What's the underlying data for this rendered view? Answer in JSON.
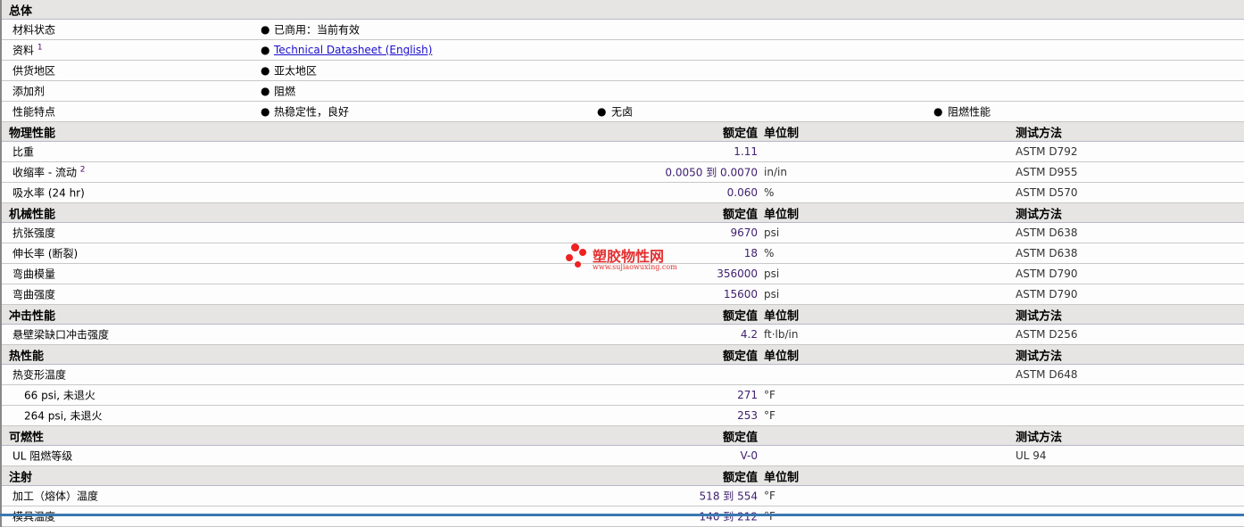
{
  "general": {
    "title": "总体",
    "rows": [
      {
        "label": "材料状态",
        "items": [
          "已商用：当前有效"
        ]
      },
      {
        "label": "资料",
        "sup": "1",
        "items": [
          "Technical Datasheet (English)"
        ],
        "link": true
      },
      {
        "label": "供货地区",
        "items": [
          "亚太地区"
        ]
      },
      {
        "label": "添加剂",
        "items": [
          "阻燃"
        ]
      },
      {
        "label": "性能特点",
        "items": [
          "热稳定性，良好",
          "无卤",
          "阻燃性能"
        ]
      }
    ]
  },
  "sections": [
    {
      "title": "物理性能",
      "col_value": "额定值",
      "col_unit": "单位制",
      "col_test": "测试方法",
      "rows": [
        {
          "label": "比重",
          "value": "1.11",
          "unit": "",
          "test": "ASTM D792"
        },
        {
          "label": "收缩率  - 流动",
          "sup": "2",
          "value": "0.0050 到  0.0070",
          "unit": "in/in",
          "test": "ASTM D955"
        },
        {
          "label": "吸水率  (24 hr)",
          "value": "0.060",
          "unit": "%",
          "test": "ASTM D570"
        }
      ]
    },
    {
      "title": "机械性能",
      "col_value": "额定值",
      "col_unit": "单位制",
      "col_test": "测试方法",
      "rows": [
        {
          "label": "抗张强度",
          "value": "9670",
          "unit": "psi",
          "test": "ASTM D638"
        },
        {
          "label": "伸长率  (断裂)",
          "value": "18",
          "unit": "%",
          "test": "ASTM D638"
        },
        {
          "label": "弯曲模量",
          "value": "356000",
          "unit": "psi",
          "test": "ASTM D790"
        },
        {
          "label": "弯曲强度",
          "value": "15600",
          "unit": "psi",
          "test": "ASTM D790"
        }
      ]
    },
    {
      "title": "冲击性能",
      "col_value": "额定值",
      "col_unit": "单位制",
      "col_test": "测试方法",
      "rows": [
        {
          "label": "悬壁梁缺口冲击强度",
          "value": "4.2",
          "unit": "ft·lb/in",
          "test": "ASTM D256"
        }
      ]
    },
    {
      "title": "热性能",
      "col_value": "额定值",
      "col_unit": "单位制",
      "col_test": "测试方法",
      "rows": [
        {
          "label": "热变形温度",
          "value": "",
          "unit": "",
          "test": "ASTM D648"
        },
        {
          "label": "66 psi, 未退火",
          "sub": true,
          "value": "271",
          "unit": "°F",
          "test": ""
        },
        {
          "label": "264 psi, 未退火",
          "sub": true,
          "value": "253",
          "unit": "°F",
          "test": ""
        }
      ]
    },
    {
      "title": "可燃性",
      "col_value": "额定值",
      "col_unit": "",
      "col_test": "测试方法",
      "rows": [
        {
          "label": "UL 阻燃等级",
          "value": "V-0",
          "unit": "",
          "test": "UL 94"
        }
      ]
    },
    {
      "title": "注射",
      "col_value": "额定值",
      "col_unit": "单位制",
      "col_test": "",
      "rows": [
        {
          "label": "加工（熔体）温度",
          "value": "518 到  554",
          "unit": "°F",
          "test": ""
        },
        {
          "label": "模具温度",
          "value": "140 到  212",
          "unit": "°F",
          "test": ""
        }
      ]
    }
  ],
  "watermark": {
    "text": "塑胶物性网",
    "url": "www.sujiaowuxing.com"
  },
  "bullet_glyph": "●"
}
